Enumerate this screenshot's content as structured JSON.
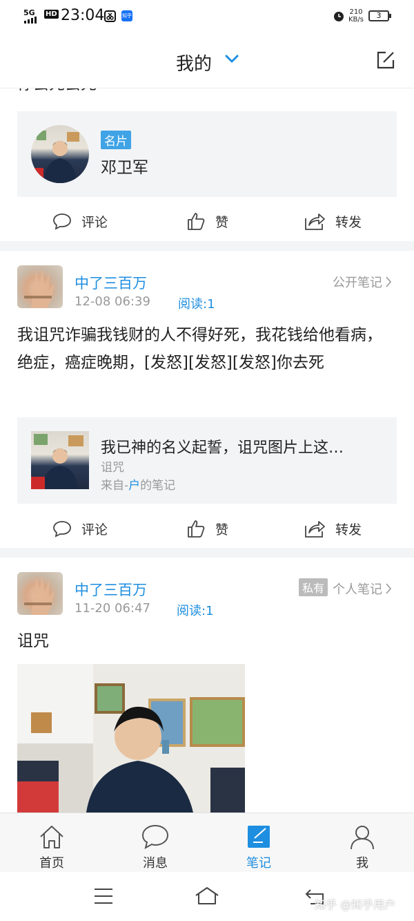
{
  "status_bar": {
    "network": "5G",
    "hd": "HD",
    "time": "23:04",
    "app_badge": "知乎",
    "speed_value": "210",
    "speed_unit": "KB/s",
    "battery": "3"
  },
  "header": {
    "title": "我的",
    "icons": [
      "chevron-down-icon",
      "edit-icon"
    ]
  },
  "post0": {
    "tail_text": "你去死去死",
    "card": {
      "tag": "名片",
      "name": "邓卫军"
    },
    "actions": {
      "comment": "评论",
      "like": "赞",
      "share": "转发"
    }
  },
  "post1": {
    "author": "中了三百万",
    "date": "12-08 06:39",
    "reads": "阅读:1",
    "visibility": "公开笔记",
    "body": "我诅咒诈骗我钱财的人不得好死，我花钱给他看病，绝症，癌症晚期，[发怒][发怒][发怒]你去死",
    "quote": {
      "title": "我已神的名义起誓，诅咒图片上这…",
      "subtitle": "诅咒",
      "source_prefix": "来自-",
      "source_user": "户",
      "source_suffix": "的笔记"
    },
    "actions": {
      "comment": "评论",
      "like": "赞",
      "share": "转发"
    }
  },
  "post2": {
    "author": "中了三百万",
    "date": "11-20 06:47",
    "reads": "阅读:1",
    "private_badge": "私有",
    "visibility": "个人笔记",
    "body": "诅咒"
  },
  "tabbar": {
    "tabs": [
      {
        "label": "首页",
        "icon": "home-icon"
      },
      {
        "label": "消息",
        "icon": "message-icon"
      },
      {
        "label": "笔记",
        "icon": "note-icon",
        "active": true
      },
      {
        "label": "我",
        "icon": "person-icon"
      }
    ]
  },
  "watermark": "知乎 @知乎用户",
  "colors": {
    "accent": "#1e8ee0",
    "separator": "#f3f4f6",
    "tag_bg": "#3fa3e6"
  }
}
